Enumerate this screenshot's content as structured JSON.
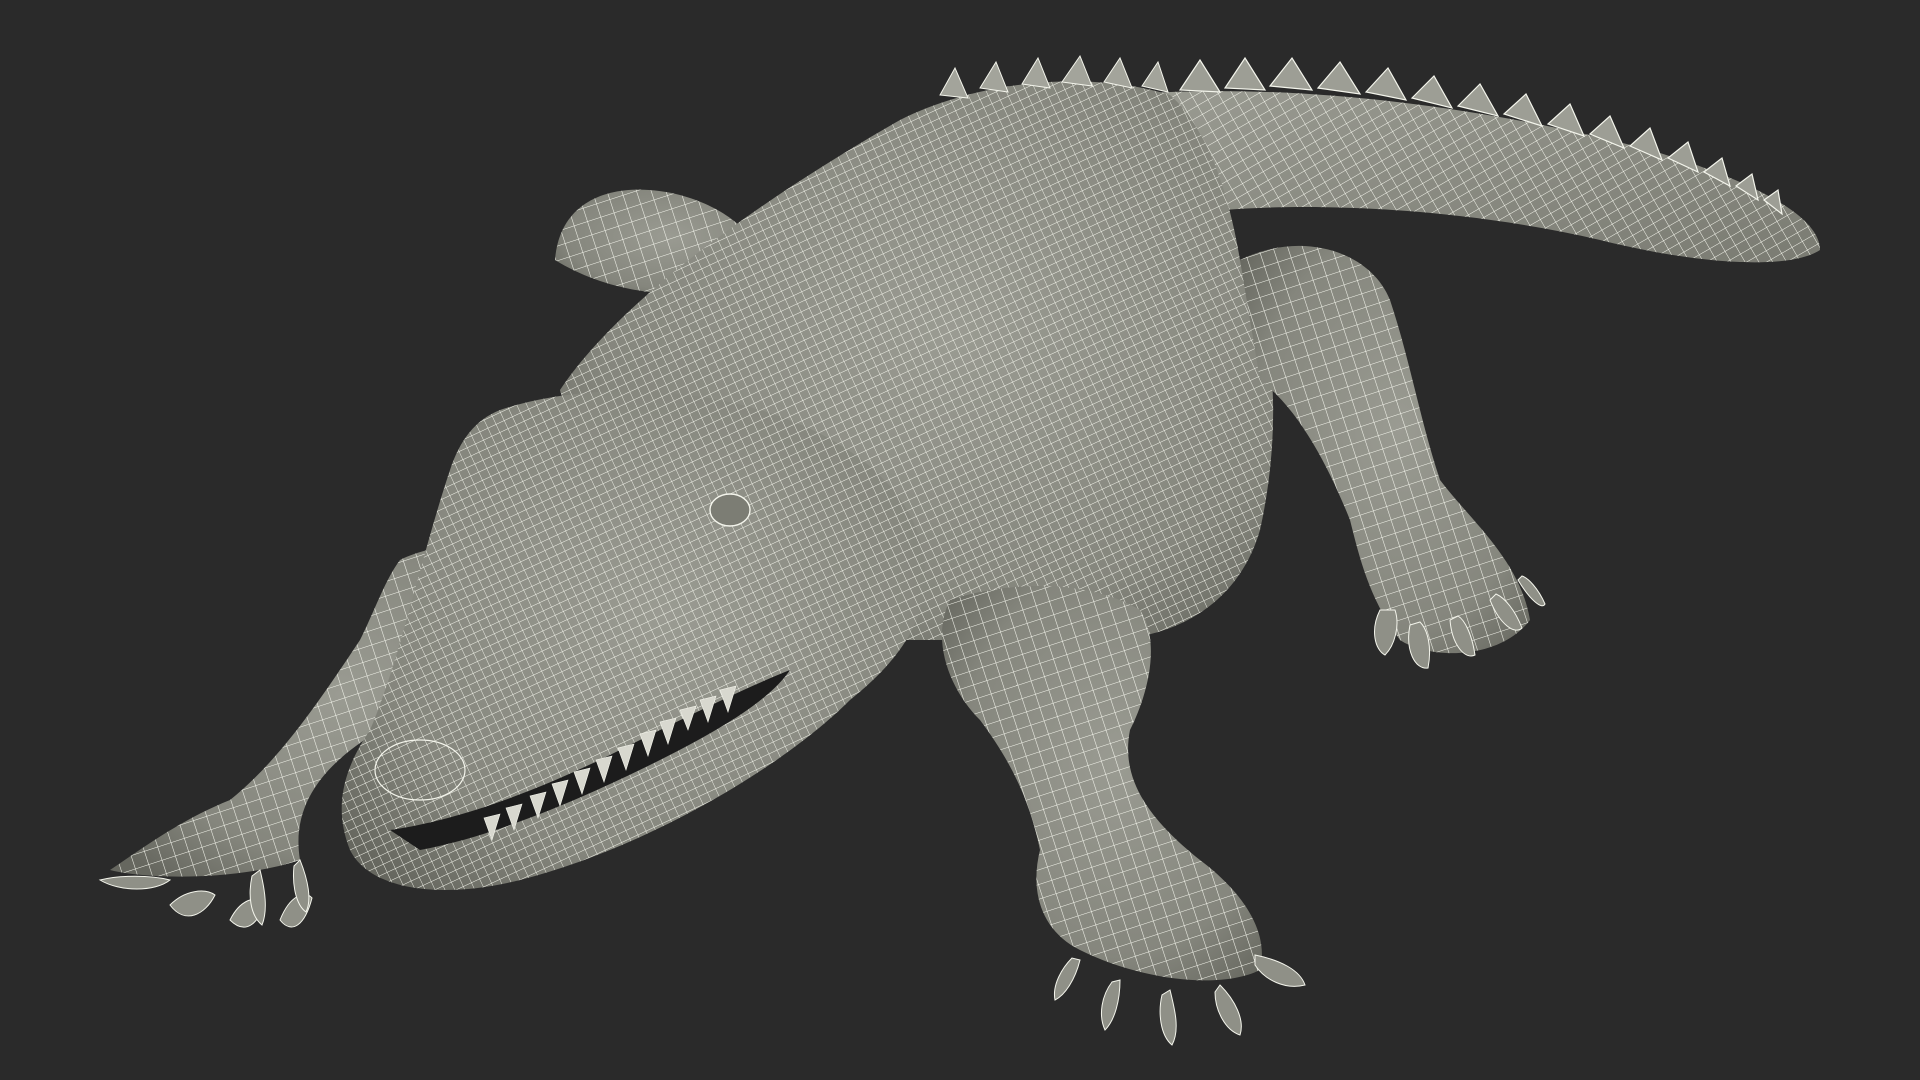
{
  "scene": {
    "subject": "crocodile-wireframe-model",
    "background_color": "#2a2a2a",
    "mesh_fill_color": "#8a8b82",
    "mesh_shadow_color": "#5d5e58",
    "mesh_highlight_color": "#b9bab1",
    "wire_color": "#f4f5ec",
    "mouth_color": "#1c1c1c",
    "teeth_color": "#d8d8cf"
  }
}
